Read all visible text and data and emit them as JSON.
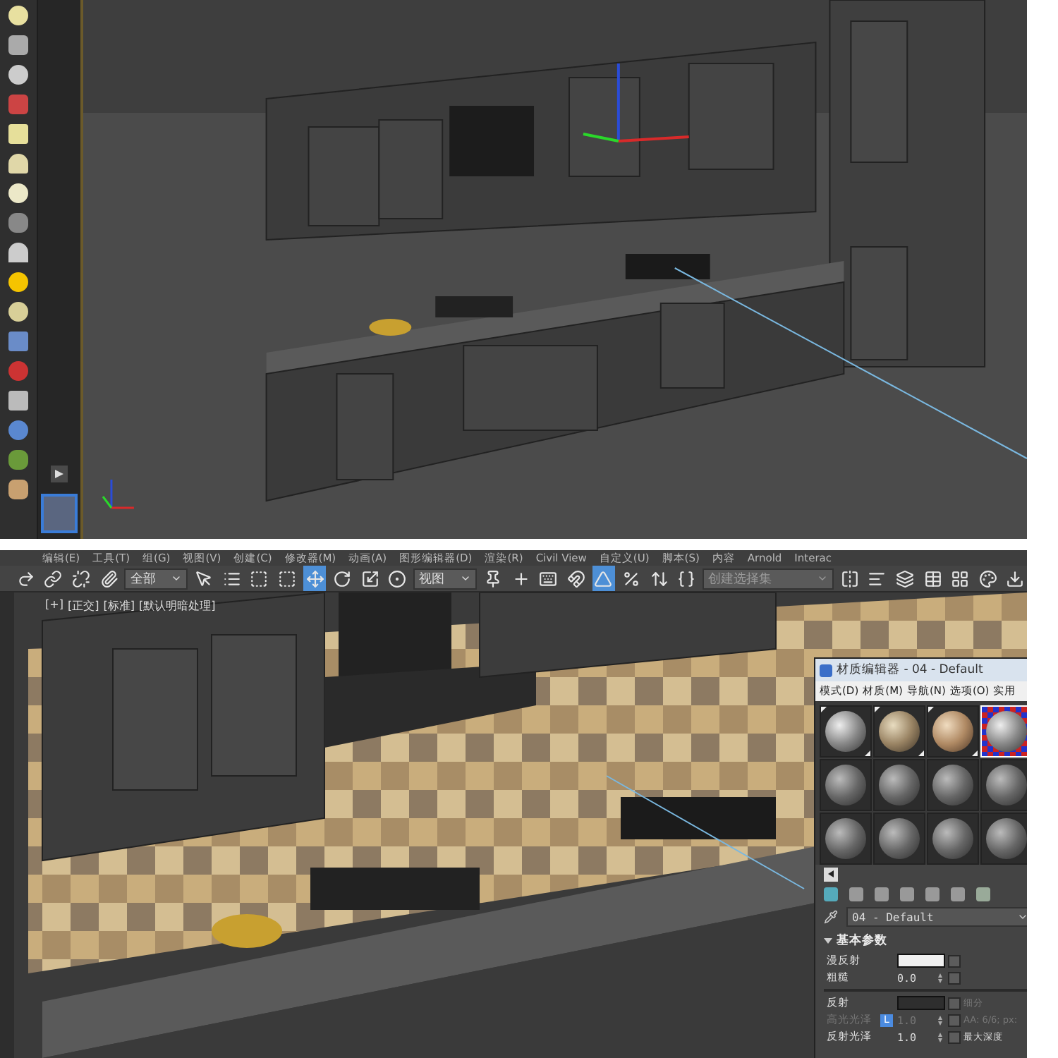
{
  "top_viewport": {
    "command_panel": {
      "expanded": false
    }
  },
  "menu_bar": [
    "编辑(E)",
    "工具(T)",
    "组(G)",
    "视图(V)",
    "创建(C)",
    "修改器(M)",
    "动画(A)",
    "图形编辑器(D)",
    "渲染(R)",
    "Civil View",
    "自定义(U)",
    "脚本(S)",
    "内容",
    "Arnold",
    "Interac"
  ],
  "toolbar": [
    {
      "kind": "redo",
      "selected": false
    },
    {
      "kind": "link",
      "selected": false
    },
    {
      "kind": "unlink",
      "selected": false
    },
    {
      "kind": "bind",
      "selected": false
    },
    {
      "kind": "dropdown",
      "value": "全部"
    },
    {
      "kind": "select",
      "selected": false
    },
    {
      "kind": "select-by-name",
      "selected": false
    },
    {
      "kind": "region",
      "selected": false
    },
    {
      "kind": "crossing",
      "selected": false
    },
    {
      "kind": "move",
      "selected": true
    },
    {
      "kind": "rotate",
      "selected": false
    },
    {
      "kind": "scale",
      "selected": false
    },
    {
      "kind": "place",
      "selected": false
    },
    {
      "kind": "dropdown",
      "value": "视图"
    },
    {
      "kind": "pivot",
      "selected": false
    },
    {
      "kind": "manipulate",
      "selected": false
    },
    {
      "kind": "keyboard",
      "selected": false
    },
    {
      "kind": "snap",
      "selected": false
    },
    {
      "kind": "angle-snap",
      "selected": true
    },
    {
      "kind": "percent-snap",
      "selected": false
    },
    {
      "kind": "spinner-snap",
      "selected": false
    },
    {
      "kind": "edit-named",
      "selected": false
    },
    {
      "kind": "dropdown",
      "placeholder": "创建选择集"
    },
    {
      "kind": "mirror",
      "selected": false
    },
    {
      "kind": "align",
      "selected": false
    },
    {
      "kind": "layers",
      "selected": false
    },
    {
      "kind": "ribbon",
      "selected": false
    },
    {
      "kind": "schematic",
      "selected": false
    },
    {
      "kind": "material",
      "selected": false
    },
    {
      "kind": "render",
      "selected": false
    }
  ],
  "viewport_labels": [
    "[+]",
    "[正交]",
    "[标准]",
    "[默认明暗处理]"
  ],
  "material_editor": {
    "title": "材质编辑器 - 04 - Default",
    "menu": [
      "模式(D)",
      "材质(M)",
      "导航(N)",
      "选项(O)",
      "实用"
    ],
    "slots": [
      {
        "kind": "grey",
        "hot": true,
        "selected": false
      },
      {
        "kind": "stone",
        "hot": true,
        "selected": false
      },
      {
        "kind": "sand",
        "hot": true,
        "selected": false
      },
      {
        "kind": "grey",
        "hot": false,
        "selected": true
      },
      {
        "kind": "dark",
        "hot": false,
        "selected": false
      },
      {
        "kind": "dark",
        "hot": false,
        "selected": false
      },
      {
        "kind": "dark",
        "hot": false,
        "selected": false
      },
      {
        "kind": "dark",
        "hot": false,
        "selected": false
      },
      {
        "kind": "dark",
        "hot": false,
        "selected": false
      },
      {
        "kind": "dark",
        "hot": false,
        "selected": false
      },
      {
        "kind": "dark",
        "hot": false,
        "selected": false
      },
      {
        "kind": "dark",
        "hot": false,
        "selected": false
      }
    ],
    "material_name": "04 - Default",
    "section": {
      "title": "基本参数",
      "expanded": true,
      "diffuse": [
        {
          "label": "漫反射",
          "kind": "swatch",
          "color": "#f0f0f0",
          "disabled": false
        },
        {
          "label": "粗糙",
          "kind": "spinner",
          "value": "0.0",
          "disabled": false
        }
      ],
      "reflection": [
        {
          "label": "反射",
          "kind": "swatch",
          "color": "#2e2e2e",
          "disabled": false,
          "side": "细分",
          "side_disabled": true
        },
        {
          "label": "高光光泽",
          "kind": "spinner",
          "value": "1.0",
          "disabled": true,
          "lock": "L",
          "side": "AA: 6/6; px:",
          "side_disabled": true
        },
        {
          "label": "反射光泽",
          "kind": "spinner",
          "value": "1.0",
          "disabled": false,
          "side": "最大深度",
          "side_disabled": false
        }
      ]
    }
  }
}
